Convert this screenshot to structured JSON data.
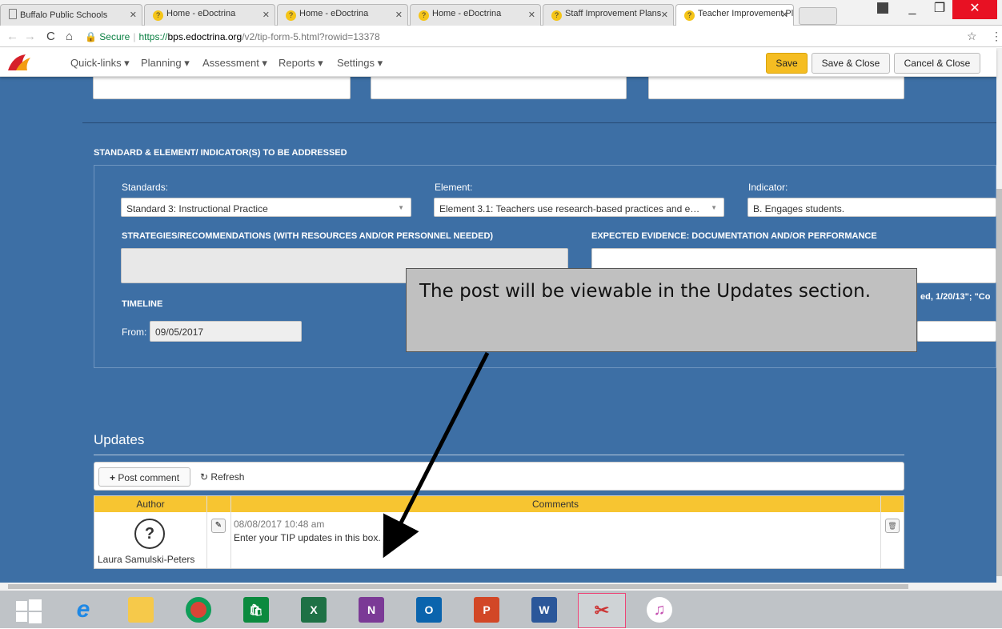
{
  "browser": {
    "tabs": [
      {
        "label": "Buffalo Public Schools",
        "active": false
      },
      {
        "label": "Home - eDoctrina",
        "active": false
      },
      {
        "label": "Home - eDoctrina",
        "active": false
      },
      {
        "label": "Home - eDoctrina",
        "active": false
      },
      {
        "label": "Staff Improvement Plans",
        "active": false
      },
      {
        "label": "Teacher Improvement Pl",
        "active": true
      }
    ],
    "url_secure": "Secure",
    "url_scheme": "https://",
    "url_host": "bps.edoctrina.org",
    "url_path": "/v2/tip-form-5.html?rowid=13378"
  },
  "nav": {
    "menu": [
      "Quick-links ▾",
      "Planning ▾",
      "Assessment ▾",
      "Reports ▾",
      "Settings ▾"
    ],
    "save": "Save",
    "save_close": "Save & Close",
    "cancel_close": "Cancel & Close"
  },
  "form": {
    "section_title": "STANDARD & ELEMENT/ INDICATOR(S) TO BE ADDRESSED",
    "standards_label": "Standards:",
    "standards_value": "Standard 3: Instructional Practice",
    "element_label": "Element:",
    "element_value": "Element 3.1: Teachers use research-based practices and e…",
    "indicator_label": "Indicator:",
    "indicator_value": "B. Engages students.",
    "strategies_label": "STRATEGIES/RECOMMENDATIONS (WITH RESOURCES AND/OR PERSONNEL NEEDED)",
    "evidence_label": "EXPECTED EVIDENCE: DOCUMENTATION AND/OR PERFORMANCE",
    "timeline_label": "TIMELINE",
    "from_label": "From:",
    "from_value": "09/05/2017",
    "partial_text": "ed, 1/20/13\"; \"Co"
  },
  "updates": {
    "title": "Updates",
    "post_comment": "Post comment",
    "refresh": "Refresh",
    "col_author": "Author",
    "col_comments": "Comments",
    "author_name": "Laura Samulski-Peters",
    "comment_date": "08/08/2017 10:48 am",
    "comment_text": "Enter your TIP updates in this box."
  },
  "callout": {
    "text": "The post will be viewable in the Updates section."
  },
  "taskbar": {
    "apps": [
      "start-icon",
      "internet-explorer-icon",
      "file-explorer-icon",
      "chrome-icon",
      "store-icon",
      "excel-icon",
      "onenote-icon",
      "outlook-icon",
      "powerpoint-icon",
      "word-icon",
      "snipping-tool-icon",
      "itunes-icon"
    ]
  }
}
